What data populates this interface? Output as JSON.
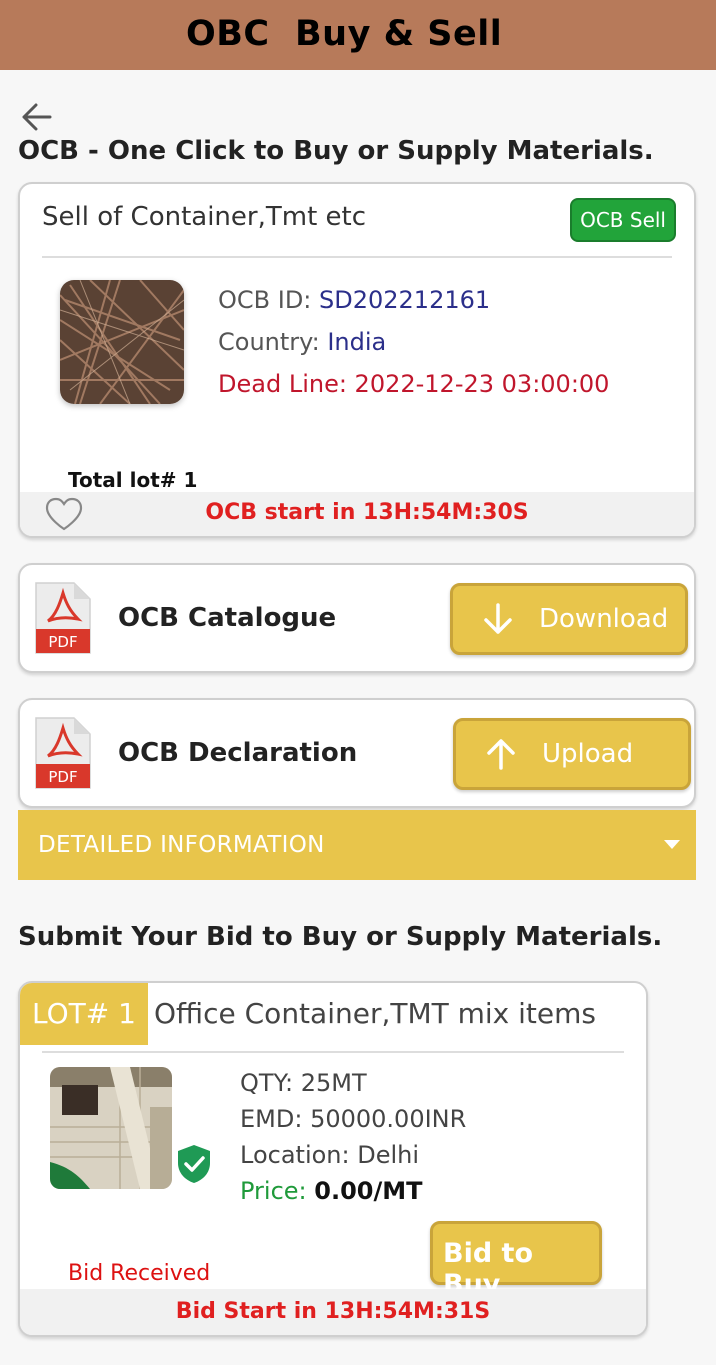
{
  "header": {
    "title": "OBC  Buy & Sell"
  },
  "page": {
    "title": "OCB - One Click to Buy or Supply Materials."
  },
  "ocb_card": {
    "title": "Sell of Container,Tmt etc",
    "badge": "OCB Sell",
    "ocb_id_label": "OCB ID: ",
    "ocb_id": "SD202212161",
    "country_label": "Country: ",
    "country": "India",
    "deadline_label": "Dead Line: ",
    "deadline": "2022-12-23 03:00:00",
    "total_lot": "Total lot# 1",
    "start_text": "OCB start in 13H:54M:30S"
  },
  "catalogue": {
    "label": "OCB Catalogue",
    "file_type": "PDF",
    "button": "Download"
  },
  "declaration": {
    "label": "OCB Declaration",
    "file_type": "PDF",
    "button": "Upload"
  },
  "detail_bar": {
    "label": "DETAILED INFORMATION"
  },
  "bid_section": {
    "title": "Submit Your Bid to Buy or Supply Materials."
  },
  "lot": {
    "tag": "LOT# 1",
    "title": "Office Container,TMT mix items",
    "qty_label": "QTY: ",
    "qty": "25MT",
    "emd_label": "EMD: ",
    "emd": "50000.00INR",
    "location_label": "Location: ",
    "location": "Delhi",
    "price_label": "Price: ",
    "price": "0.00/MT",
    "bid_button": "Bid to Buy",
    "bid_status": "Bid Received",
    "start_text": "Bid Start in 13H:54M:31S"
  },
  "colors": {
    "header": "#b77a5a",
    "accent": "#e8c54b",
    "badge": "#22a43a",
    "alert": "#e02020",
    "link": "#2b2f8a"
  }
}
